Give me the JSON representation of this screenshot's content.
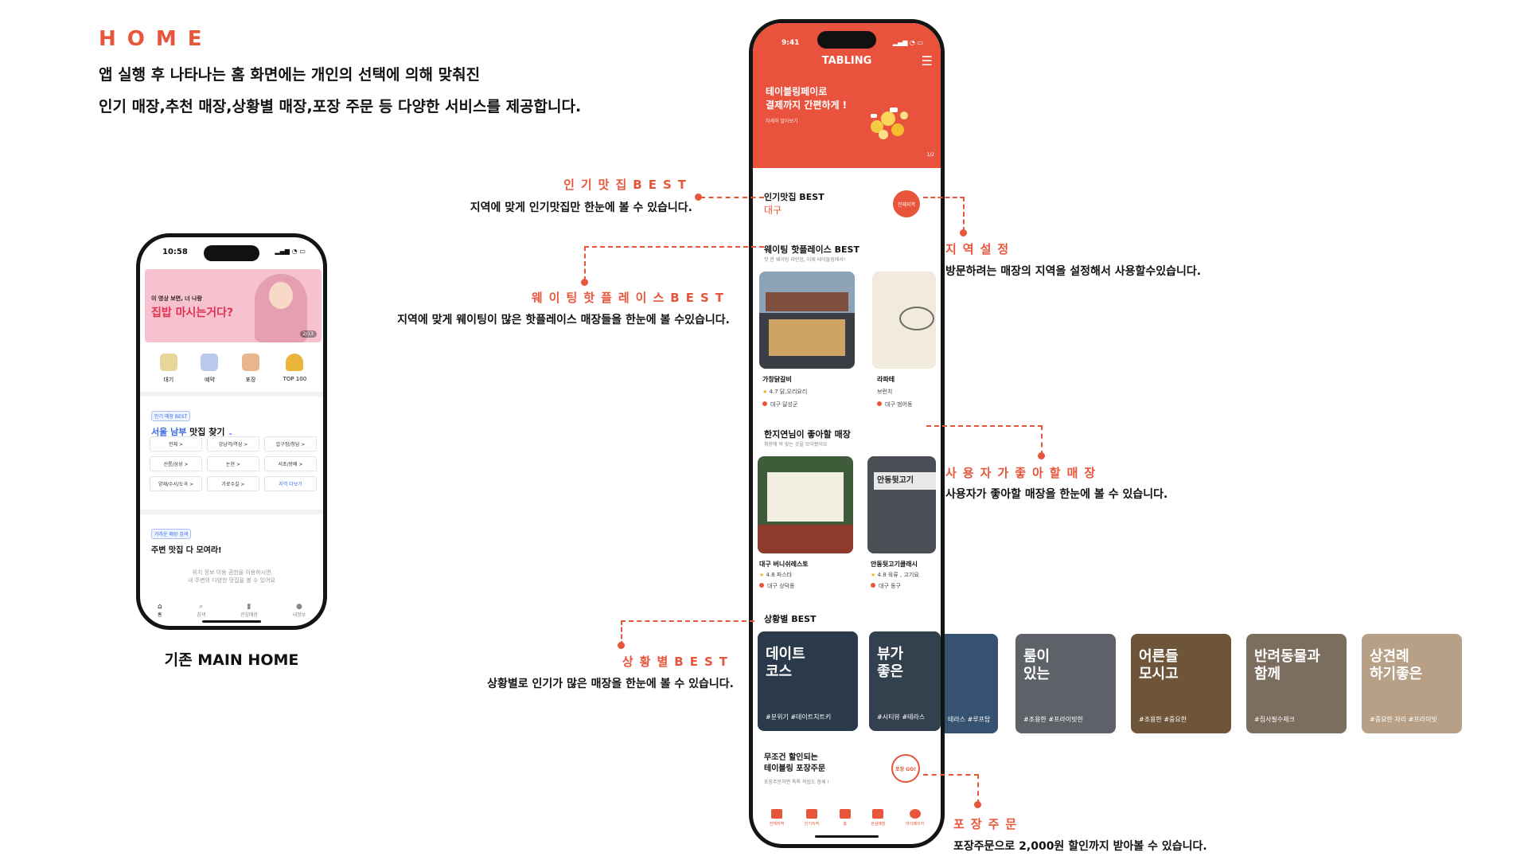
{
  "header": {
    "title": "HOME",
    "desc_line1": "앱 실행 후 나타나는 홈 화면에는 개인의 선택에 의해 맞춰진",
    "desc_line2": "인기 매장,추천 매장,상황별 매장,포장 주문 등 다양한 서비스를 제공합니다."
  },
  "old_phone": {
    "time": "10:58",
    "banner_line1": "이 영상 보면, 너 나랑",
    "banner_line2": "집밥 마시는거다?",
    "banner_page": "2/13",
    "icons": [
      {
        "label": "대기",
        "icon": "hourglass-icon",
        "color": "#E9D59A"
      },
      {
        "label": "예약",
        "icon": "calendar-icon",
        "color": "#B9C9EC"
      },
      {
        "label": "포장",
        "icon": "bag-icon",
        "color": "#E8B58C"
      },
      {
        "label": "TOP 100",
        "icon": "trophy-icon",
        "color": "#E9B53A"
      }
    ],
    "popular_tag": "인기 매장 BEST",
    "region_title_accent": "서울 남부",
    "region_title_rest": " 맛집 찾기",
    "chips": [
      "전체 >",
      "강남역/역삼 >",
      "압구정/청담 >",
      "선릉/삼성 >",
      "논현 >",
      "서초/방배 >",
      "양재/수서/도곡 >",
      "가로수길 >",
      "지역 더보기"
    ],
    "nearby_tag": "가까운 매장 검색",
    "nearby_title": "주변 맛집 다 모여라!",
    "location_note_1": "위치 정보 이용 권한을 이용하시면",
    "location_note_2": "내 주변의 다양한 맛집을 볼 수 있어요",
    "nav": [
      "홈",
      "검색",
      "관심매장",
      "내정보"
    ],
    "caption": "기존 MAIN HOME"
  },
  "new_phone": {
    "time": "9:41",
    "app_title": "TABLING",
    "banner_line1": "테이블링페이로",
    "banner_line2": "결제까지 간편하게 !",
    "banner_more": "자세히 알아보기",
    "banner_page": "1/2",
    "popular_title": "인기맛집 BEST",
    "popular_region": "대구",
    "region_button": "전체지역",
    "waiting_title": "웨이팅 핫플레이스 BEST",
    "waiting_sub": "핫 한 웨이팅 라인업, 이제 테이블링에서!",
    "waiting_cards": [
      {
        "name": "가창닭갈비",
        "rating": "4.7",
        "category": "닭,오리요리",
        "area": "대구 달성군"
      },
      {
        "name": "라파테",
        "rating": "",
        "category": "브런치",
        "area": "대구 범어동"
      }
    ],
    "like_title": "한지연님이 좋아할 매장",
    "like_sub": "취향에 딱 맞는 곳을 모아봤어요",
    "like_cards": [
      {
        "name": "대구 버니쉬레스토",
        "rating": "4.8",
        "category": "파스타",
        "area": "대구 상덕동"
      },
      {
        "name": "안동뒷고기클래시",
        "rating": "4.8",
        "category": "육류 , 고기요",
        "area": "대구 동구"
      }
    ],
    "sign_text": "안동뒷고기",
    "situation_title": "상황별 BEST",
    "situation_cards": [
      {
        "title_l1": "데이트",
        "title_l2": "코스",
        "tags": "#분위기 #데이트치트키",
        "bg": "#2B3A4A"
      },
      {
        "title_l1": "뷰가",
        "title_l2": "좋은",
        "tags": "#시티뷰 #테라스",
        "bg": "#33414F"
      }
    ],
    "takeout_line1": "무조건 할인되는",
    "takeout_line2": "테이블링 포장주문",
    "takeout_sub": "포장주문하면 톡톡 적립도 함께 !",
    "takeout_badge": "포장 GO!",
    "nav": [
      "전체지역",
      "인기지역",
      "홈",
      "관심매장",
      "마이페이지"
    ]
  },
  "extra_situations": [
    {
      "title_l1": "",
      "title_l2": "",
      "tags": "테라스 #루프탑",
      "bg": "#355270"
    },
    {
      "title_l1": "룸이",
      "title_l2": "있는",
      "tags": "#조용한 #프라이빗한",
      "bg": "#5E6268"
    },
    {
      "title_l1": "어른들",
      "title_l2": "모시고",
      "tags": "#조용한 #중요한",
      "bg": "#6E5438"
    },
    {
      "title_l1": "반려동물과",
      "title_l2": "함께",
      "tags": "#집사필수체크",
      "bg": "#7C6E5E"
    },
    {
      "title_l1": "상견례",
      "title_l2": "하기좋은",
      "tags": "#중요한 자리 #프라이빗",
      "bg": "#B7A086"
    }
  ],
  "annotations": {
    "popular": {
      "title": "인기맛집BEST",
      "desc": "지역에 맞게 인기맛집만 한눈에 볼 수 있습니다."
    },
    "waiting": {
      "title": "웨이팅핫플레이스BEST",
      "desc": "지역에 맞게 웨이팅이 많은 핫플레이스 매장들을 한눈에 볼 수있습니다."
    },
    "situation": {
      "title": "상황별BEST",
      "desc": "상황별로 인기가 많은 매장을 한눈에 볼 수 있습니다."
    },
    "region": {
      "title": "지역설정",
      "desc": "방문하려는 매장의 지역을 설정해서 사용할수있습니다."
    },
    "like": {
      "title": "사용자가좋아할매장",
      "desc": "사용자가 좋아할 매장을 한눈에 볼 수 있습니다."
    },
    "takeout": {
      "title": "포장주문",
      "desc": "포장주문으로 2,000원 할인까지 받아볼 수 있습니다."
    }
  },
  "colors": {
    "accent": "#E8553A",
    "header_bg": "#E9533D",
    "link_blue": "#3A6BE8"
  }
}
